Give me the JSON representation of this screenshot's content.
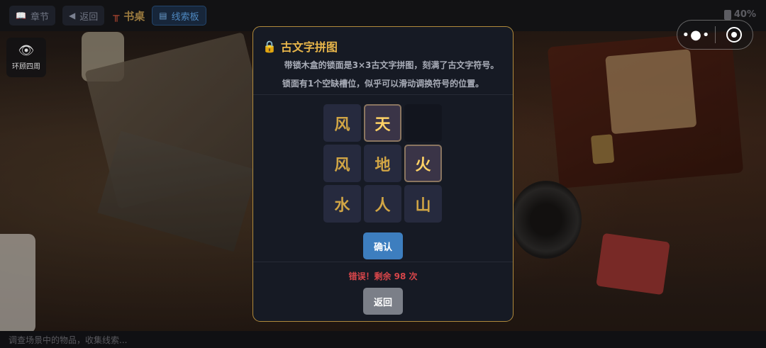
{
  "topbar": {
    "chapter_label": "章节",
    "chapter_icon": "book-icon",
    "back_label": "返回",
    "back_icon": "back-arrow-icon",
    "location_title": "书桌",
    "location_icon": "desk-icon",
    "clue_label": "线索板",
    "clue_icon": "clipboard-icon",
    "battery": "40%"
  },
  "look_around": {
    "label": "环顾四周",
    "icon": "eye-icon"
  },
  "modal": {
    "title": "古文字拼图",
    "title_icon": "lock-icon",
    "desc1": "带锁木盒的锁面是3×3古文字拼图，刻满了古文字符号。",
    "desc2": "锁面有1个空缺槽位，似乎可以滑动调换符号的位置。",
    "grid": [
      [
        {
          "char": "风",
          "state": "normal"
        },
        {
          "char": "天",
          "state": "selected"
        },
        {
          "char": "",
          "state": "empty"
        }
      ],
      [
        {
          "char": "风",
          "state": "normal"
        },
        {
          "char": "地",
          "state": "normal"
        },
        {
          "char": "火",
          "state": "selected"
        }
      ],
      [
        {
          "char": "水",
          "state": "normal"
        },
        {
          "char": "人",
          "state": "normal"
        },
        {
          "char": "山",
          "state": "normal"
        }
      ]
    ],
    "confirm_label": "确认",
    "error_text": "错误！剩余 98 次",
    "back_label": "返回"
  },
  "status_bar": {
    "text": "调查场景中的物品，收集线索..."
  },
  "colors": {
    "accent_gold": "#e7b54a",
    "modal_border": "#b08a3c",
    "confirm_blue": "#3d7ebf",
    "error_red": "#d9464a"
  }
}
